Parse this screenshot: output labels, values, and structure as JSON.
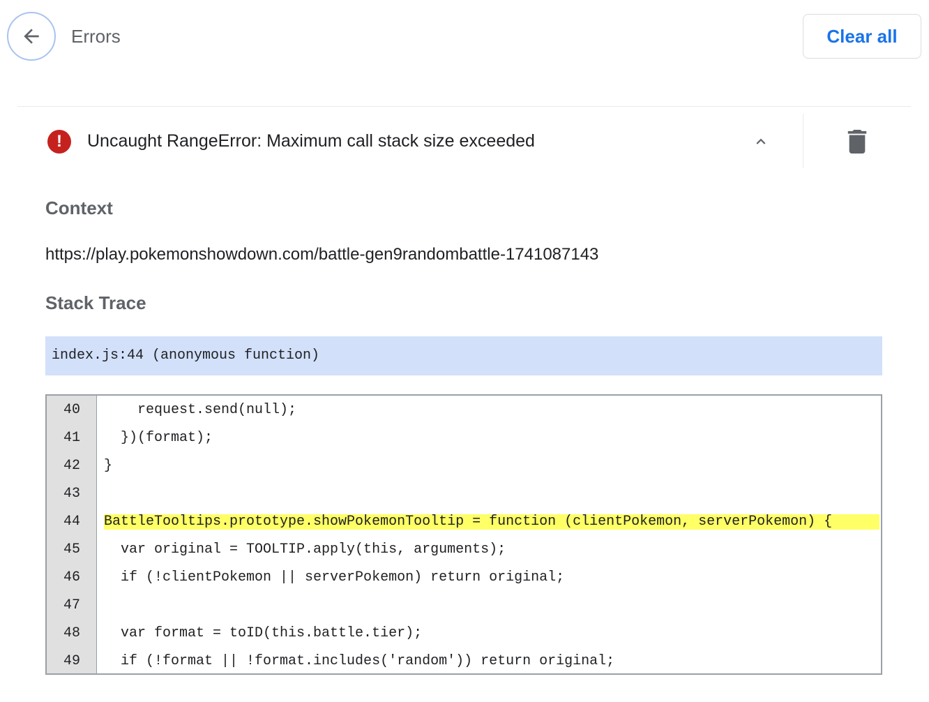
{
  "header": {
    "title": "Errors",
    "clear_all_label": "Clear all"
  },
  "error": {
    "message": "Uncaught RangeError: Maximum call stack size exceeded",
    "icon": "!",
    "expanded": true
  },
  "details": {
    "context_heading": "Context",
    "context_url": "https://play.pokemonshowdown.com/battle-gen9randombattle-1741087143",
    "stack_heading": "Stack Trace",
    "frame": "index.js:44 (anonymous function)"
  },
  "code": {
    "highlighted_line": 44,
    "lines": [
      {
        "num": "40",
        "text": "    request.send(null);"
      },
      {
        "num": "41",
        "text": "  })(format);"
      },
      {
        "num": "42",
        "text": "}"
      },
      {
        "num": "43",
        "text": ""
      },
      {
        "num": "44",
        "text": "BattleTooltips.prototype.showPokemonTooltip = function (clientPokemon, serverPokemon) {"
      },
      {
        "num": "45",
        "text": "  var original = TOOLTIP.apply(this, arguments);"
      },
      {
        "num": "46",
        "text": "  if (!clientPokemon || serverPokemon) return original;"
      },
      {
        "num": "47",
        "text": ""
      },
      {
        "num": "48",
        "text": "  var format = toID(this.battle.tier);"
      },
      {
        "num": "49",
        "text": "  if (!format || !format.includes('random')) return original;"
      }
    ]
  },
  "colors": {
    "accent": "#1a73e8",
    "error": "#c5221f",
    "frame_bg": "#d2e0fa",
    "highlight": "#ffff66"
  }
}
